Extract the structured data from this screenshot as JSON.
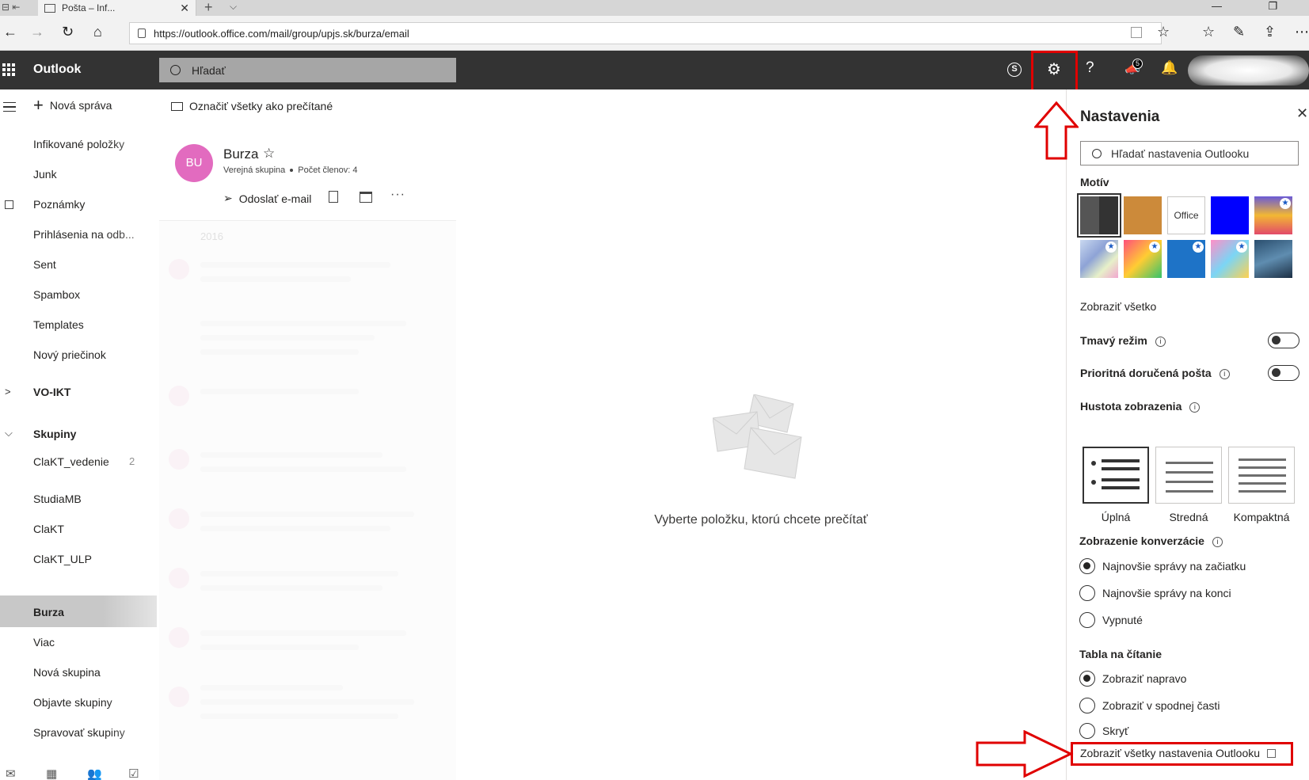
{
  "browser": {
    "tab_title": "Pošta – Inf...",
    "url": "https://outlook.office.com/mail/group/upjs.sk/burza/email"
  },
  "header": {
    "brand": "Outlook",
    "search_placeholder": "Hľadať",
    "notification_count": "5",
    "icons": [
      "skype-icon",
      "gear-icon",
      "help-icon",
      "megaphone-icon",
      "bell-icon"
    ]
  },
  "command_bar": {
    "new_message": "Nová správa",
    "mark_all_read": "Označiť všetky ako prečítané"
  },
  "nav": {
    "items": [
      {
        "label": "Infikované položky"
      },
      {
        "label": "Junk"
      },
      {
        "label": "Poznámky"
      },
      {
        "label": "Prihlásenia na odb..."
      },
      {
        "label": "Sent"
      },
      {
        "label": "Spambox"
      },
      {
        "label": "Templates"
      },
      {
        "label": "Nový priečinok"
      }
    ],
    "vo_ikt": "VO-IKT",
    "groups_header": "Skupiny",
    "groups": [
      {
        "label": "ClaKT_vedenie",
        "count": "2"
      },
      {
        "label": "StudiaMB"
      },
      {
        "label": "ClaKT"
      },
      {
        "label": "ClaKT_ULP"
      },
      {
        "label": "Burza"
      },
      {
        "label": "Viac"
      },
      {
        "label": "Nová skupina"
      },
      {
        "label": "Objavte skupiny"
      },
      {
        "label": "Spravovať skupiny"
      }
    ]
  },
  "group_card": {
    "initials": "BU",
    "name": "Burza",
    "type": "Verejná skupina",
    "members": "Počet členov: 4",
    "send_email": "Odoslať e-mail",
    "avatar_color": "#e26bbf"
  },
  "message_list": {
    "year": "2016"
  },
  "reading_pane": {
    "empty_message": "Vyberte položku, ktorú chcete prečítať"
  },
  "settings": {
    "title": "Nastavenia",
    "search_placeholder": "Hľadať nastavenia Outlooku",
    "theme_header": "Motív",
    "theme_office_label": "Office",
    "show_all": "Zobraziť všetko",
    "dark_mode": "Tmavý režim",
    "dark_mode_on": false,
    "focused_inbox": "Prioritná doručená pošta",
    "focused_inbox_on": false,
    "density_header": "Hustota zobrazenia",
    "density_options": [
      "Úplná",
      "Stredná",
      "Kompaktná"
    ],
    "density_selected": "Úplná",
    "conversation_header": "Zobrazenie konverzácie",
    "conversation_options": [
      "Najnovšie správy na začiatku",
      "Najnovšie správy na konci",
      "Vypnuté"
    ],
    "conversation_selected": "Najnovšie správy na začiatku",
    "reading_pane_header": "Tabla na čítanie",
    "reading_options": [
      "Zobraziť napravo",
      "Zobraziť v spodnej časti",
      "Skryť"
    ],
    "reading_selected": "Zobraziť napravo",
    "view_all_settings": "Zobraziť všetky nastavenia Outlooku"
  },
  "colors": {
    "header_bg": "#333333",
    "highlight_red": "#e00000",
    "selected_nav": "#c8c8c8"
  }
}
